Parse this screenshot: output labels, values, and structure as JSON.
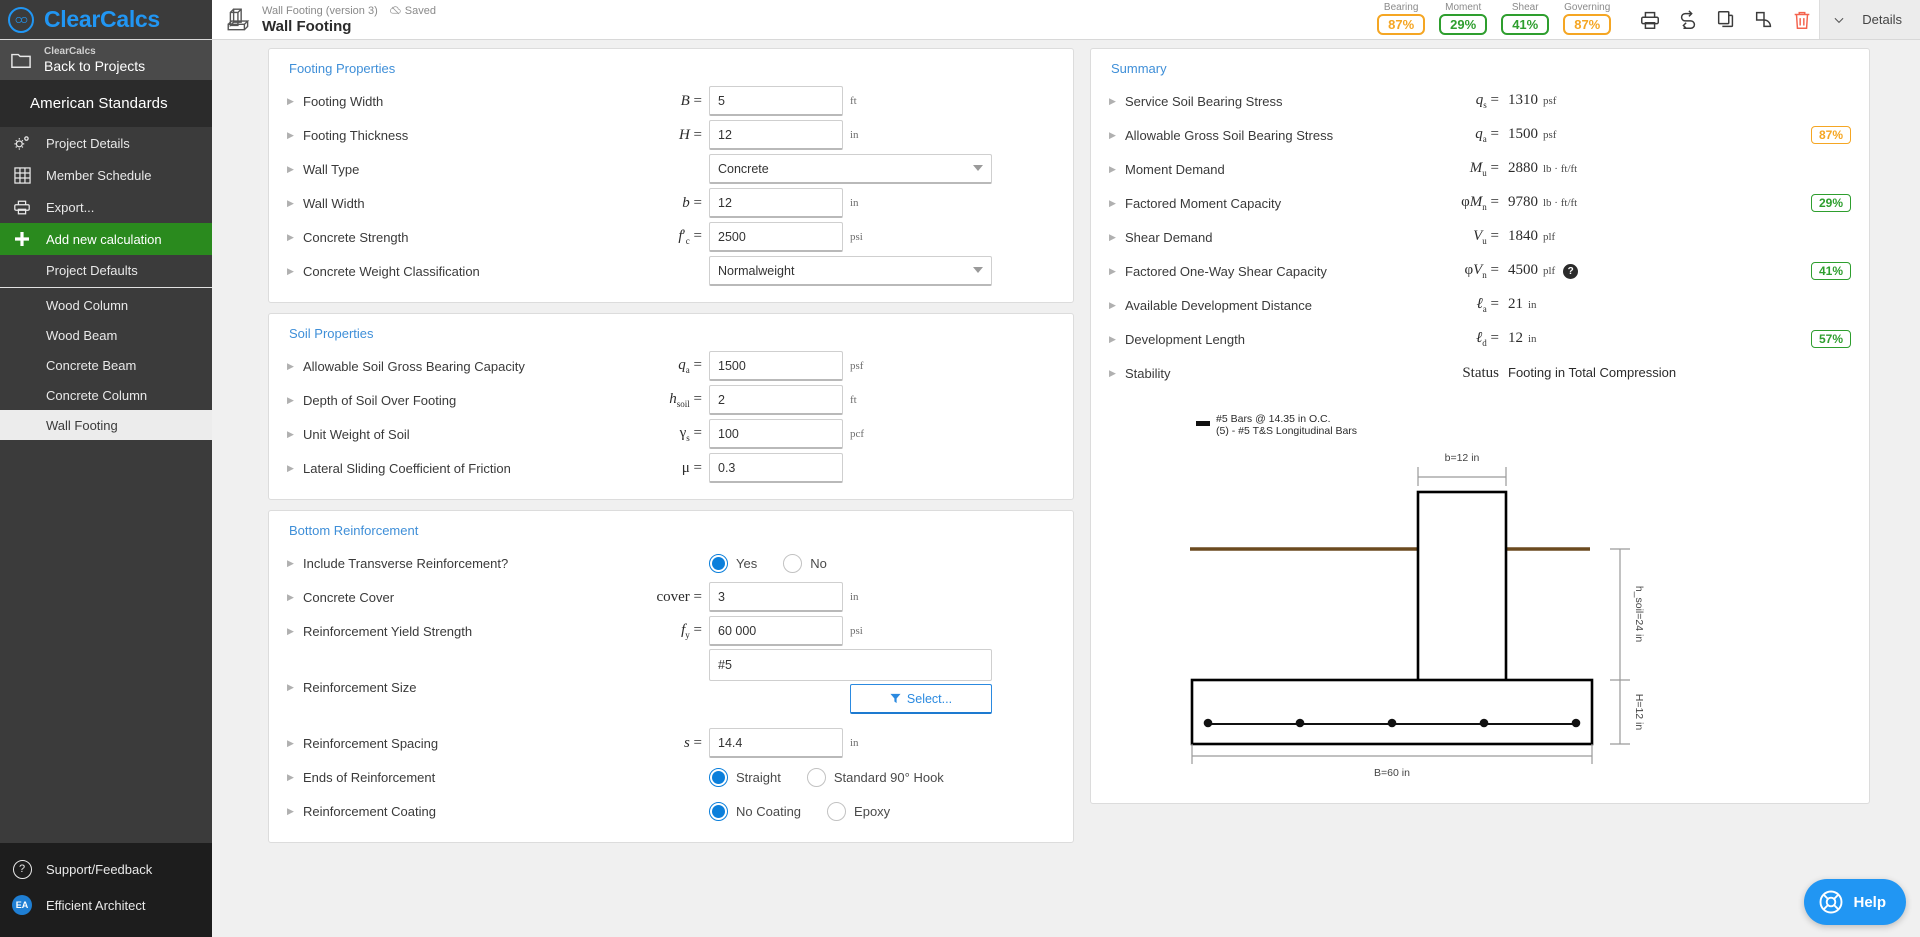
{
  "brand": {
    "name": "ClearCalcs",
    "logo_icon": "clearcalcs-logo-icon"
  },
  "sidebar": {
    "back": {
      "top": "ClearCalcs",
      "bottom": "Back to Projects",
      "icon": "folder-icon"
    },
    "standards": "American Standards",
    "items": [
      {
        "label": "Project Details",
        "icon": "gears-icon"
      },
      {
        "label": "Member Schedule",
        "icon": "grid-table-icon"
      },
      {
        "label": "Export...",
        "icon": "printer-icon"
      },
      {
        "label": "Add new calculation",
        "icon": "plus-icon"
      },
      {
        "label": "Project Defaults",
        "icon": ""
      },
      {
        "label": "Wood Column",
        "icon": ""
      },
      {
        "label": "Wood Beam",
        "icon": ""
      },
      {
        "label": "Concrete Beam",
        "icon": ""
      },
      {
        "label": "Concrete Column",
        "icon": ""
      },
      {
        "label": "Wall Footing",
        "icon": ""
      }
    ],
    "footer": [
      {
        "label": "Support/Feedback",
        "icon": "question-circle-icon"
      },
      {
        "label": "Efficient Architect",
        "icon": "avatar",
        "initials": "EA"
      }
    ]
  },
  "header": {
    "doc_icon": "wall-footing-icon",
    "version": "Wall Footing (version 3)",
    "saved": "Saved",
    "saved_icon": "cloud-saved-icon",
    "title": "Wall Footing",
    "ratios": [
      {
        "label": "Bearing",
        "value": "87%",
        "status": "amber"
      },
      {
        "label": "Moment",
        "value": "29%",
        "status": "green"
      },
      {
        "label": "Shear",
        "value": "41%",
        "status": "green"
      },
      {
        "label": "Governing",
        "value": "87%",
        "status": "amber"
      }
    ],
    "toolbar": [
      {
        "icon": "print-icon"
      },
      {
        "icon": "swap-arrows-icon"
      },
      {
        "icon": "copy-icon"
      },
      {
        "icon": "duplicate-shapes-icon"
      },
      {
        "icon": "trash-icon"
      }
    ],
    "details_label": "Details",
    "chevron_icon": "chevron-down-icon"
  },
  "footing_properties": {
    "title": "Footing Properties",
    "rows": [
      {
        "label": "Footing Width",
        "sym": "B",
        "sub": "",
        "type": "input",
        "value": "5",
        "unit": "ft"
      },
      {
        "label": "Footing Thickness",
        "sym": "H",
        "sub": "",
        "type": "input",
        "value": "12",
        "unit": "in"
      },
      {
        "label": "Wall Type",
        "sym": "",
        "sub": "",
        "type": "select",
        "value": "Concrete",
        "unit": ""
      },
      {
        "label": "Wall Width",
        "sym": "b",
        "sub": "",
        "type": "input",
        "value": "12",
        "unit": "in"
      },
      {
        "label": "Concrete Strength",
        "sym": "f'",
        "sub": "c",
        "type": "input",
        "value": "2500",
        "unit": "psi"
      },
      {
        "label": "Concrete Weight Classification",
        "sym": "",
        "sub": "",
        "type": "select",
        "value": "Normalweight",
        "unit": ""
      }
    ]
  },
  "soil_properties": {
    "title": "Soil Properties",
    "rows": [
      {
        "label": "Allowable Soil Gross Bearing Capacity",
        "sym": "q",
        "sub": "a",
        "type": "input",
        "value": "1500",
        "unit": "psf"
      },
      {
        "label": "Depth of Soil Over Footing",
        "sym": "h",
        "sub": "soil",
        "type": "input",
        "value": "2",
        "unit": "ft"
      },
      {
        "label": "Unit Weight of Soil",
        "sym": "γ",
        "sub": "s",
        "type": "input",
        "value": "100",
        "unit": "pcf"
      },
      {
        "label": "Lateral Sliding Coefficient of Friction",
        "sym": "μ",
        "sub": "",
        "type": "input",
        "value": "0.3",
        "unit": ""
      }
    ]
  },
  "bottom_reinforcement": {
    "title": "Bottom Reinforcement",
    "transverse": {
      "label": "Include Transverse Reinforcement?",
      "options": [
        "Yes",
        "No"
      ],
      "selected": "Yes"
    },
    "cover": {
      "label": "Concrete Cover",
      "sym": "cover",
      "sub": "",
      "value": "3",
      "unit": "in"
    },
    "fy": {
      "label": "Reinforcement Yield Strength",
      "sym": "f",
      "sub": "y",
      "value": "60 000",
      "unit": "psi"
    },
    "size": {
      "label": "Reinforcement Size",
      "value": "#5",
      "select_button": "Select...",
      "select_icon": "funnel-icon"
    },
    "spacing": {
      "label": "Reinforcement Spacing",
      "sym": "s",
      "sub": "",
      "value": "14.4",
      "unit": "in"
    },
    "ends": {
      "label": "Ends of Reinforcement",
      "options": [
        "Straight",
        "Standard 90° Hook"
      ],
      "selected": "Straight"
    },
    "coating": {
      "label": "Reinforcement Coating",
      "options": [
        "No Coating",
        "Epoxy"
      ],
      "selected": "No Coating"
    }
  },
  "summary": {
    "title": "Summary",
    "rows": [
      {
        "label": "Service Soil Bearing Stress",
        "sym": "q",
        "sub": "s",
        "value": "1310",
        "unit": "psf",
        "pill": "",
        "pill_status": "",
        "help": false
      },
      {
        "label": "Allowable Gross Soil Bearing Stress",
        "sym": "q",
        "sub": "a",
        "value": "1500",
        "unit": "psf",
        "pill": "87%",
        "pill_status": "amber",
        "help": false
      },
      {
        "label": "Moment Demand",
        "sym": "M",
        "sub": "u",
        "value": "2880",
        "unit": "lb · ft/ft",
        "pill": "",
        "pill_status": "",
        "help": false
      },
      {
        "label": "Factored Moment Capacity",
        "sym": "φM",
        "sub": "n",
        "value": "9780",
        "unit": "lb · ft/ft",
        "pill": "29%",
        "pill_status": "green",
        "help": false
      },
      {
        "label": "Shear Demand",
        "sym": "V",
        "sub": "u",
        "value": "1840",
        "unit": "plf",
        "pill": "",
        "pill_status": "",
        "help": false
      },
      {
        "label": "Factored One-Way Shear Capacity",
        "sym": "φV",
        "sub": "n",
        "value": "4500",
        "unit": "plf",
        "pill": "41%",
        "pill_status": "green",
        "help": true
      },
      {
        "label": "Available Development Distance",
        "sym": "ℓ",
        "sub": "a",
        "value": "21",
        "unit": "in",
        "pill": "",
        "pill_status": "",
        "help": false
      },
      {
        "label": "Development Length",
        "sym": "ℓ",
        "sub": "d",
        "value": "12",
        "unit": "in",
        "pill": "57%",
        "pill_status": "green",
        "help": false
      }
    ],
    "stability": {
      "label": "Stability",
      "sym": "Status",
      "value": "Footing in Total Compression"
    }
  },
  "diagram": {
    "legend_line1": "#5 Bars @ 14.35 in O.C.",
    "legend_line2": "(5) - #5 T&S Longitudinal Bars",
    "wall_dim": "b=12 in",
    "footing_dim": "B=60 in",
    "soil_dim": "h_soil=24 in",
    "thickness_dim": "H=12 in",
    "bar_count": 5,
    "soil_color": "#6b4a20",
    "outline_color": "#000000"
  },
  "help_fab": {
    "label": "Help",
    "icon": "lifebuoy-icon"
  }
}
